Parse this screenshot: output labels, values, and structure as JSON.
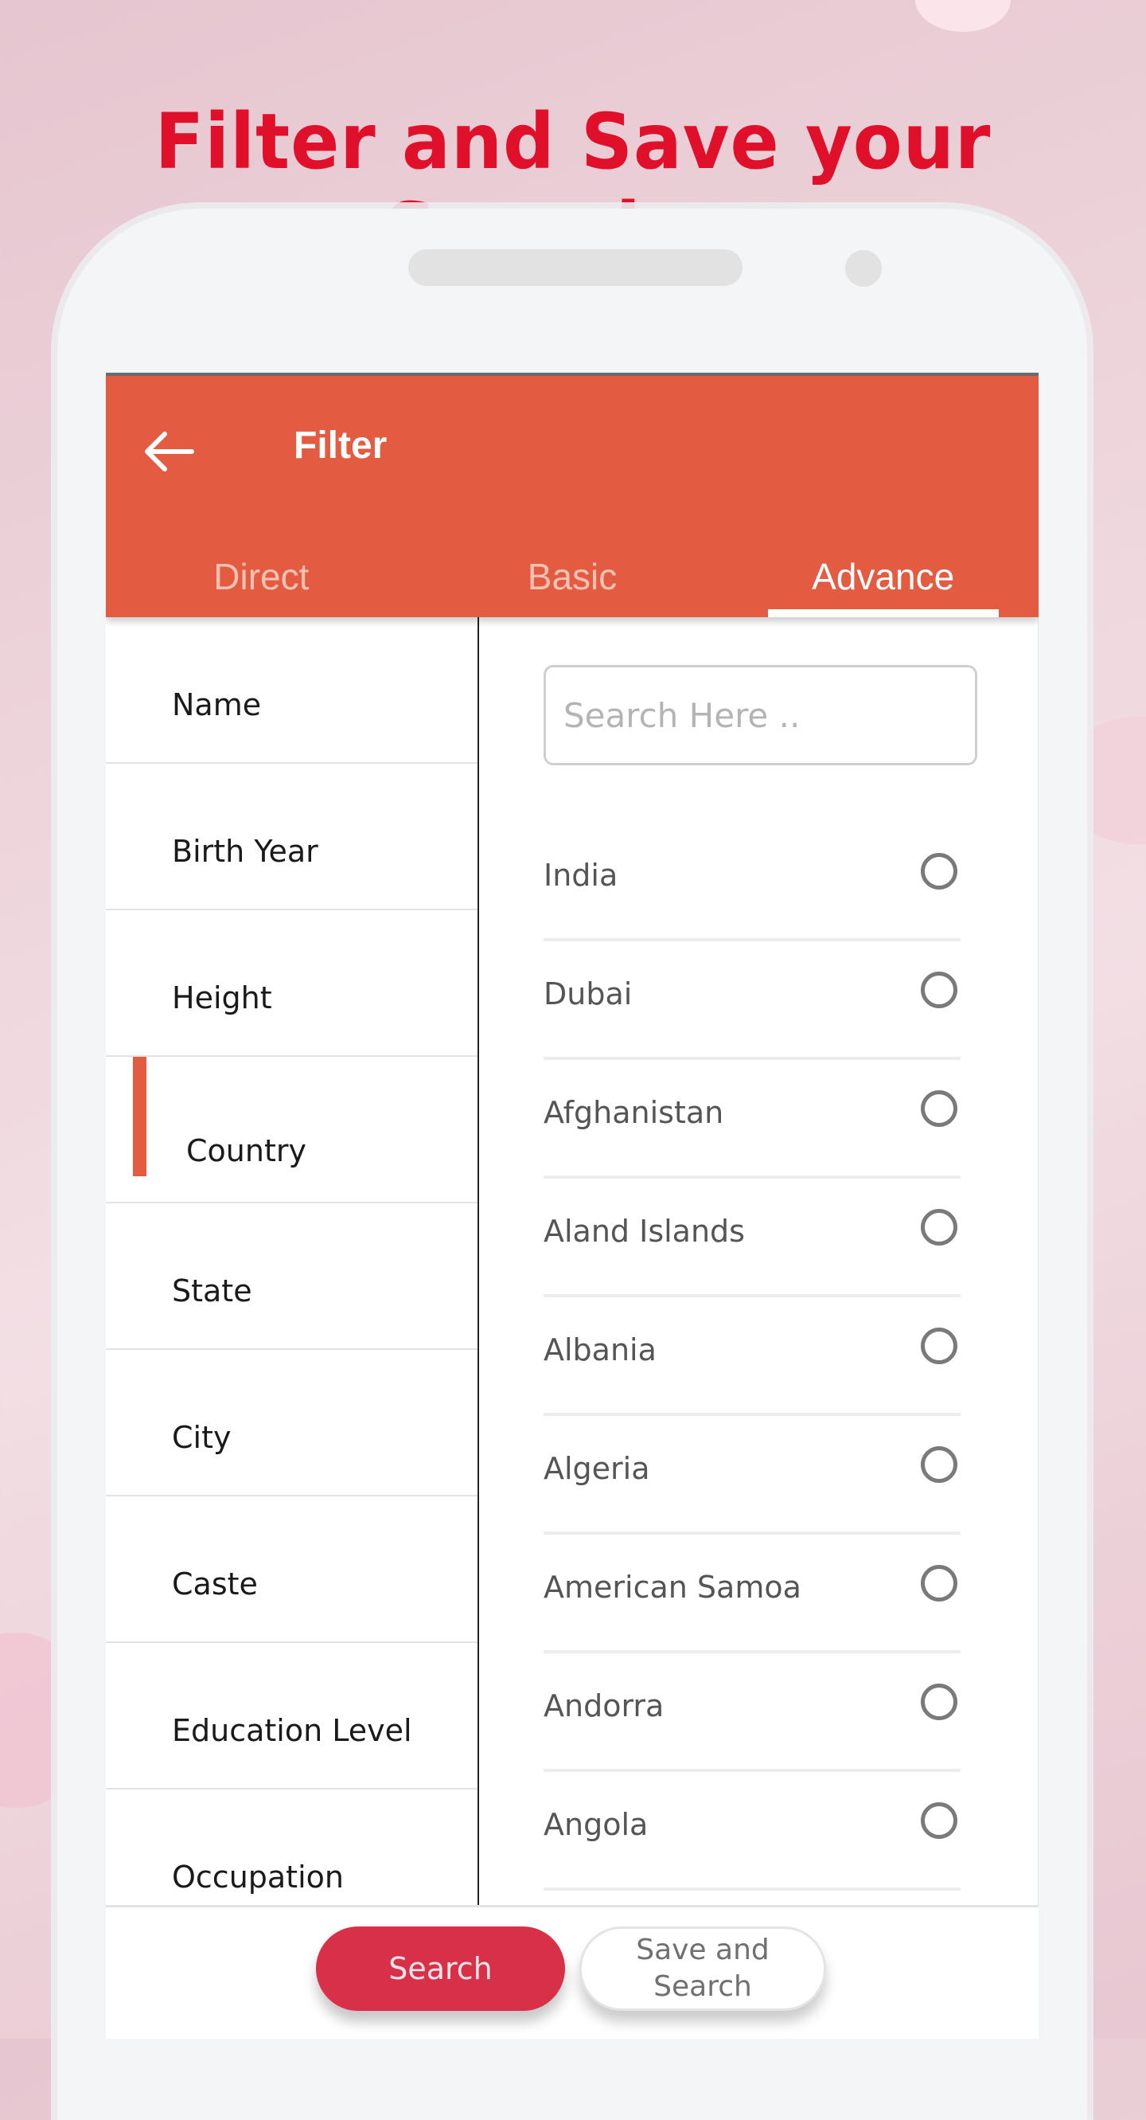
{
  "promo": {
    "headline": "Filter and Save your Searches",
    "headline_color": "#e0102a"
  },
  "appbar": {
    "title": "Filter",
    "back_icon": "arrow-left-icon",
    "color": "#e35b40"
  },
  "tabs": [
    {
      "label": "Direct",
      "active": false
    },
    {
      "label": "Basic",
      "active": false
    },
    {
      "label": "Advance",
      "active": true
    }
  ],
  "categories": [
    {
      "label": "Name"
    },
    {
      "label": "Birth Year"
    },
    {
      "label": "Height"
    },
    {
      "label": "Country",
      "active": true
    },
    {
      "label": "State"
    },
    {
      "label": "City"
    },
    {
      "label": "Caste"
    },
    {
      "label": "Education Level"
    },
    {
      "label": "Occupation"
    }
  ],
  "search": {
    "placeholder": "Search Here ..",
    "value": ""
  },
  "countries": [
    {
      "name": "India",
      "selected": false
    },
    {
      "name": "Dubai",
      "selected": false
    },
    {
      "name": "Afghanistan",
      "selected": false
    },
    {
      "name": "Aland Islands",
      "selected": false
    },
    {
      "name": "Albania",
      "selected": false
    },
    {
      "name": "Algeria",
      "selected": false
    },
    {
      "name": "American Samoa",
      "selected": false
    },
    {
      "name": "Andorra",
      "selected": false
    },
    {
      "name": "Angola",
      "selected": false
    }
  ],
  "actions": {
    "search_label": "Search",
    "save_search_label": "Save and\nSearch"
  }
}
